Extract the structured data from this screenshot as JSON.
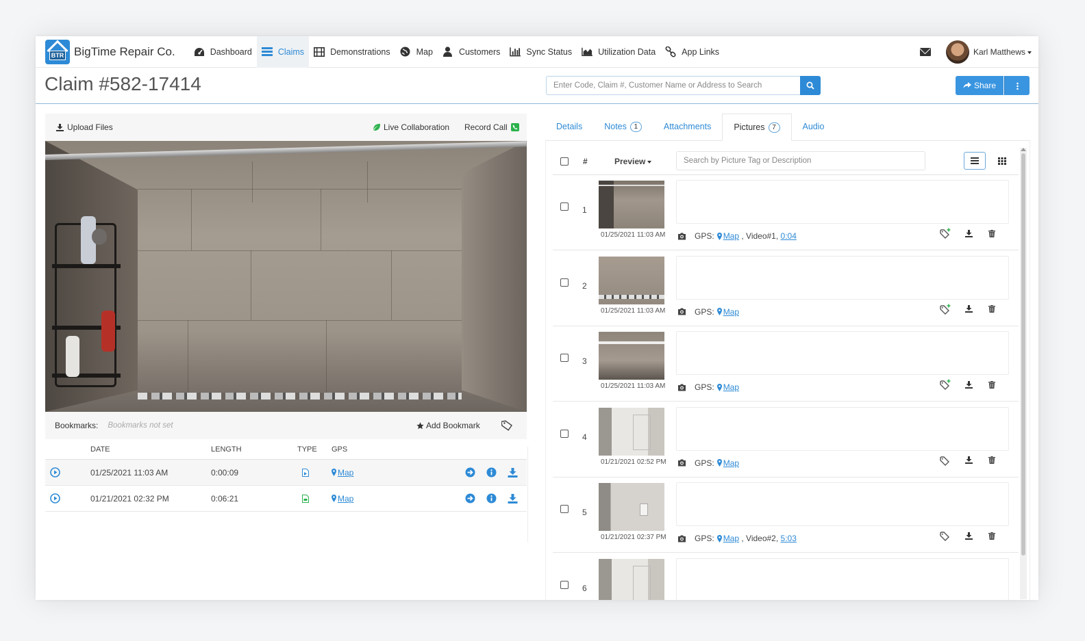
{
  "brand": {
    "name": "BigTime Repair Co.",
    "logo_text": "BTR"
  },
  "nav": {
    "items": [
      {
        "label": "Dashboard",
        "icon": "dashboard-icon"
      },
      {
        "label": "Claims",
        "icon": "claims-icon",
        "active": true
      },
      {
        "label": "Demonstrations",
        "icon": "film-icon"
      },
      {
        "label": "Map",
        "icon": "globe-icon"
      },
      {
        "label": "Customers",
        "icon": "user-icon"
      },
      {
        "label": "Sync Status",
        "icon": "bar-chart-icon"
      },
      {
        "label": "Utilization Data",
        "icon": "area-chart-icon"
      },
      {
        "label": "App Links",
        "icon": "link-icon"
      }
    ],
    "user_name": "Karl Matthews"
  },
  "header": {
    "title": "Claim #582-17414",
    "search_placeholder": "Enter Code, Claim #, Customer Name or Address to Search",
    "share_label": "Share"
  },
  "left": {
    "upload_label": "Upload Files",
    "live_collab_label": "Live Collaboration",
    "record_call_label": "Record Call",
    "bookmarks_label": "Bookmarks:",
    "bookmarks_empty": "Bookmarks not set",
    "add_bookmark_label": "Add Bookmark",
    "table": {
      "columns": [
        "DATE",
        "LENGTH",
        "TYPE",
        "GPS"
      ],
      "rows": [
        {
          "date": "01/25/2021 11:03 AM",
          "length": "0:00:09",
          "gps": "Map"
        },
        {
          "date": "01/21/2021 02:32 PM",
          "length": "0:06:21",
          "gps": "Map"
        }
      ]
    }
  },
  "right": {
    "tabs": [
      {
        "label": "Details"
      },
      {
        "label": "Notes",
        "badge": "1"
      },
      {
        "label": "Attachments"
      },
      {
        "label": "Pictures",
        "badge": "7",
        "active": true
      },
      {
        "label": "Audio"
      }
    ],
    "pictures": {
      "num_header": "#",
      "preview_header": "Preview",
      "search_placeholder": "Search by Picture Tag or Description",
      "gps_label": "GPS:",
      "rows": [
        {
          "num": "1",
          "date": "01/25/2021 11:03 AM",
          "map": "Map",
          "video": "Video#1,",
          "time": "0:04"
        },
        {
          "num": "2",
          "date": "01/25/2021 11:03 AM",
          "map": "Map"
        },
        {
          "num": "3",
          "date": "01/25/2021 11:03 AM",
          "map": "Map"
        },
        {
          "num": "4",
          "date": "01/21/2021 02:52 PM",
          "map": "Map"
        },
        {
          "num": "5",
          "date": "01/21/2021 02:37 PM",
          "map": "Map",
          "video": "Video#2,",
          "time": "5:03"
        },
        {
          "num": "6"
        }
      ]
    }
  },
  "colors": {
    "accent": "#2d8ad6",
    "call_green": "#2bb24c",
    "share_blue": "#3a95e0"
  }
}
